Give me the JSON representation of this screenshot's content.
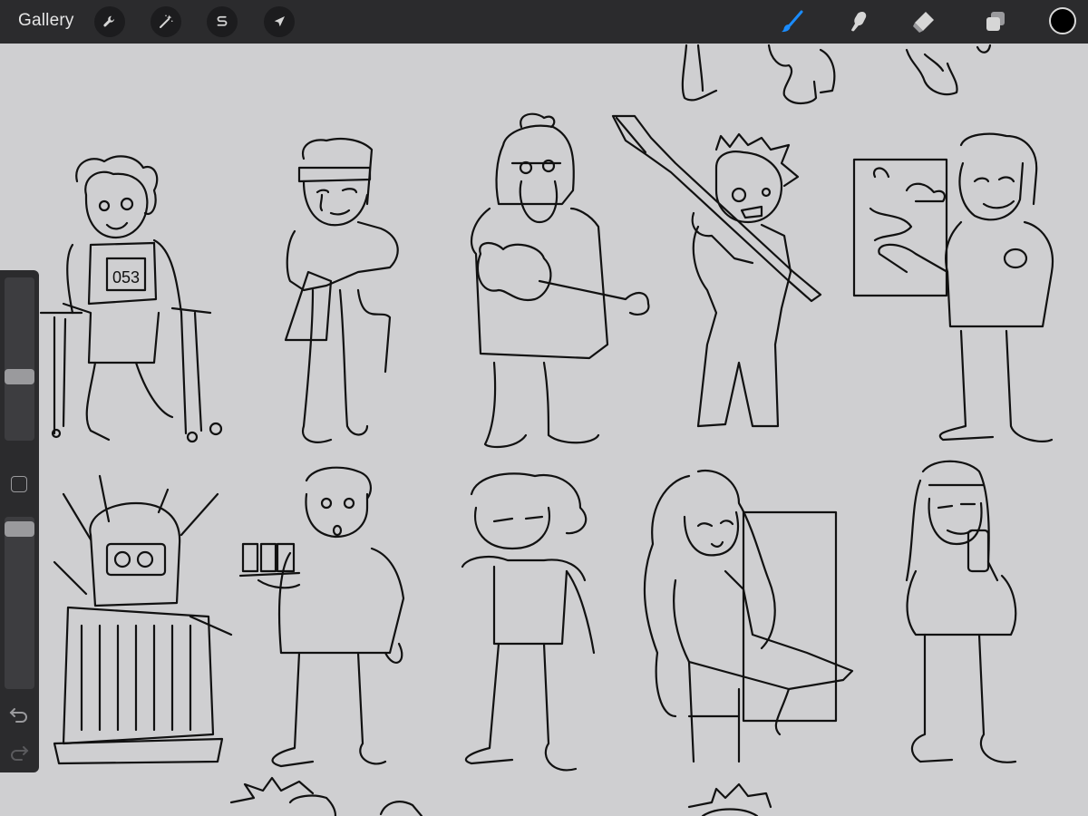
{
  "topbar": {
    "gallery_label": "Gallery",
    "left_tools": [
      {
        "name": "actions",
        "icon": "wrench-icon"
      },
      {
        "name": "adjustments",
        "icon": "magic-wand-icon"
      },
      {
        "name": "selection",
        "icon": "selection-s-icon"
      },
      {
        "name": "transform",
        "icon": "arrow-cursor-icon"
      }
    ],
    "right_tools": [
      {
        "name": "brush",
        "icon": "brush-icon",
        "active": true
      },
      {
        "name": "smudge",
        "icon": "smudge-finger-icon",
        "active": false
      },
      {
        "name": "eraser",
        "icon": "eraser-icon",
        "active": false
      },
      {
        "name": "layers",
        "icon": "layers-icon",
        "active": false
      }
    ],
    "current_color": "#000000",
    "active_tool_color": "#1a8cff"
  },
  "sidebar": {
    "brush_size_level": 0.38,
    "opacity_level": 0.03,
    "modify_icon": "square-icon",
    "undo_icon": "undo-arrow-icon",
    "redo_icon": "redo-arrow-icon"
  },
  "canvas": {
    "background": "#cfcfd1",
    "drawing": "sketch-sheet-of-characters",
    "bib_number": "053"
  }
}
